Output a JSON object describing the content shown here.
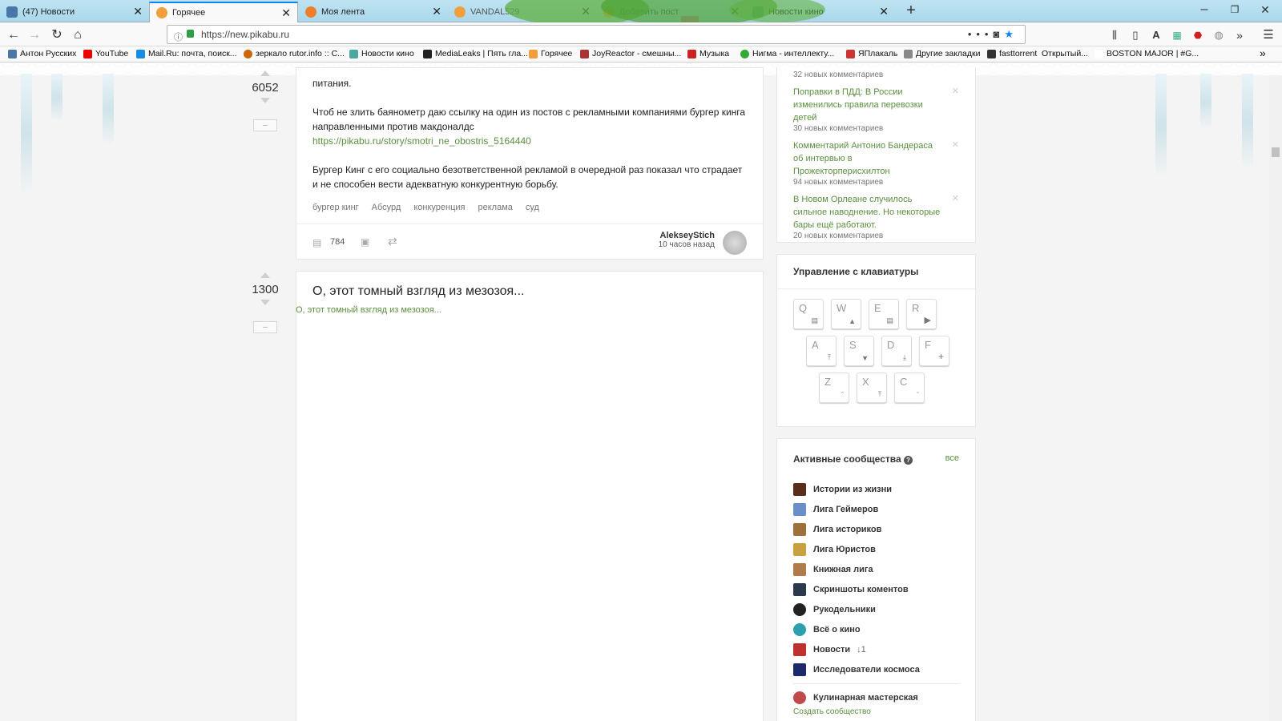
{
  "browser": {
    "tabs": [
      {
        "label": "(47) Новости",
        "fav": "#4a76a8"
      },
      {
        "label": "Горячее",
        "fav": "#f29e3d"
      },
      {
        "label": "Моя лента",
        "fav": "#ef7d2a"
      },
      {
        "label": "VANDAL529",
        "fav": "#f29e3d"
      },
      {
        "label": "Добавить пост",
        "fav": "#f29e3d"
      },
      {
        "label": "Новости кино",
        "fav": "#4aa8a0"
      }
    ],
    "url": "https://new.pikabu.ru",
    "bookmarks": [
      {
        "label": "Антон Русских",
        "color": "#4a76a8"
      },
      {
        "label": "YouTube",
        "color": "#e00"
      },
      {
        "label": "Mail.Ru: почта, поиск...",
        "color": "#168de2"
      },
      {
        "label": "зеркало rutor.info :: С...",
        "color": "#c60"
      },
      {
        "label": "Новости кино",
        "color": "#4aa8a0"
      },
      {
        "label": "MediaLeaks | Пять гла...",
        "color": "#222"
      },
      {
        "label": "Горячее",
        "color": "#f29e3d"
      },
      {
        "label": "JoyReactor - смешны...",
        "color": "#a33"
      },
      {
        "label": "Музыка",
        "color": "#c22"
      },
      {
        "label": "Нигма - интеллекту...",
        "color": "#3a3"
      },
      {
        "label": "ЯПлакаль",
        "color": "#c33"
      },
      {
        "label": "Другие закладки",
        "color": "#888"
      },
      {
        "label": "fasttorrent",
        "color": "#333"
      },
      {
        "label": "Открытый...",
        "color": "#999"
      },
      {
        "label": "BOSTON MAJOR | #G...",
        "color": "#fff"
      }
    ]
  },
  "post1": {
    "rating": "6052",
    "text_top": "питания.",
    "para1": "Чтоб не злить баянометр даю ссылку на один из постов с рекламными компаниями бургер кинга направленными против макдоналдс",
    "link": "https://pikabu.ru/story/smotri_ne_obostris_5164440",
    "para2": "Бургер Кинг с его социально безответственной рекламой в очередной раз показал что страдает и не способен вести адекватную конкурентную борьбу.",
    "tags": [
      "бургер кинг",
      "Абсурд",
      "конкуренция",
      "реклама",
      "суд"
    ],
    "comments": "784",
    "author": "AlekseyStich",
    "time": "10 часов назад",
    "minus": "–"
  },
  "post2": {
    "rating": "1300",
    "title": "О, этот томный взгляд из мезозоя...",
    "alt": "О, этот томный взгляд из мезозоя...",
    "minus": "–"
  },
  "sidebar": {
    "news": [
      {
        "title": "",
        "count": "32 новых комментариев"
      },
      {
        "title": "Поправки в ПДД: В России изменились правила перевозки детей",
        "count": "30 новых комментариев"
      },
      {
        "title": "Комментарий Антонио Бандераса об интервью в Прожекторперисхилтон",
        "count": "94 новых комментариев"
      },
      {
        "title": "В Новом Орлеане случилось сильное наводнение. Но некоторые бары ещё работают.",
        "count": "20 новых комментариев"
      }
    ],
    "keyboard_title": "Управление с клавиатуры",
    "keys": [
      "Q",
      "W",
      "E",
      "R",
      "A",
      "S",
      "D",
      "F",
      "Z",
      "X",
      "C"
    ],
    "communities_title": "Активные сообщества",
    "communities_all": "все",
    "communities": [
      {
        "name": "Истории из жизни",
        "color": "#5a2d1a"
      },
      {
        "name": "Лига Геймеров",
        "color": "#6a8fc8"
      },
      {
        "name": "Лига историков",
        "color": "#a0703a"
      },
      {
        "name": "Лига Юристов",
        "color": "#c8a040"
      },
      {
        "name": "Книжная лига",
        "color": "#b07a4a"
      },
      {
        "name": "Скриншоты коментов",
        "color": "#2a3a4a"
      },
      {
        "name": "Рукодельники",
        "color": "#222"
      },
      {
        "name": "Всё о кино",
        "color": "#2aa0b0"
      },
      {
        "name": "Новости",
        "color": "#c03030"
      },
      {
        "name": "Исследователи космоса",
        "color": "#1a2a6a"
      },
      {
        "name": "Кулинарная мастерская",
        "color": "#c04a4a"
      }
    ],
    "news_badge": "↓1",
    "create": "Создать сообщество"
  }
}
